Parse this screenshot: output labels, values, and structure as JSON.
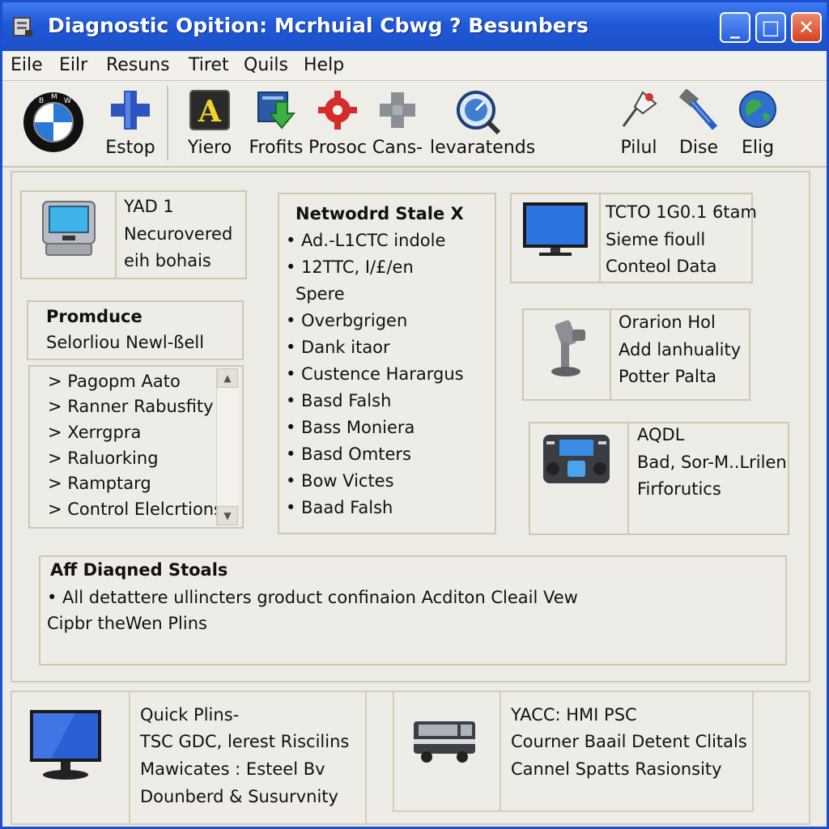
{
  "window": {
    "title": "Diagnostic Opition: Mcrhuial Cbwg ? Besunbers",
    "buttons": {
      "minimize": "_",
      "maximize": "□",
      "close": "✕"
    }
  },
  "menu": [
    "Eile",
    "Eilr",
    "Resuns",
    "Tiret",
    "Quils",
    "Help"
  ],
  "toolbar": {
    "left": [
      {
        "label": "",
        "icon": "bmw-logo-icon"
      },
      {
        "label": "Estop",
        "icon": "plus-icon"
      },
      {
        "label": "Yiero",
        "icon": "letter-a-icon"
      },
      {
        "label": "Frofits",
        "icon": "download-icon"
      },
      {
        "label": "Prosoc",
        "icon": "gear-icon"
      },
      {
        "label": "Cans-",
        "icon": "puzzle-icon"
      },
      {
        "label": "levaratends",
        "icon": "magnifier-icon"
      }
    ],
    "right": [
      {
        "label": "Pilul",
        "icon": "pin-icon"
      },
      {
        "label": "Dise",
        "icon": "hammer-icon"
      },
      {
        "label": "Elig",
        "icon": "globe-icon"
      }
    ]
  },
  "panels": {
    "device": {
      "lines": [
        "YAD 1",
        "Necurovered",
        "eih bohais"
      ]
    },
    "produce": {
      "title": "Promduce",
      "subtitle": "Selorliou Newl-ßell"
    },
    "produce_list": [
      "> Pagopm Aato",
      "> Ranner Rabusfity",
      "> Xerrgpra",
      "> Raluorking",
      "> Ramptarg",
      "> Control Elelcrtions"
    ],
    "network": {
      "title": "Netwodrd Stale X",
      "items": [
        "• Ad.-L1CTC indole",
        "• 12TTC, I/£/en",
        "Spere",
        "• Overbgrigen",
        "• Dank itaor",
        "• Custence Harargus",
        "• Basd Falsh",
        "• Bass Moniera",
        "• Basd Omters",
        "• Bow Victes",
        "• Baad Falsh"
      ]
    },
    "monitor": {
      "lines": [
        "TCTO 1G0.1 6tam",
        "Sieme fioull",
        "Conteol Data"
      ]
    },
    "orarion": {
      "lines": [
        "Orarion Hol",
        "Add lanhuality",
        "Potter Palta"
      ]
    },
    "aqdl": {
      "lines": [
        "AQDL",
        "Bad, Sor-M..Lrilen",
        "Firforutics"
      ]
    },
    "diagnosed": {
      "title": "Aff Diaqned Stoals",
      "line1": "• All  detattere ullincters groduct confinaion Acditon Cleail Vew",
      "line2": "Cipbr theWen Plins"
    },
    "quick": {
      "lines": [
        "Quick Plins-",
        "TSC GDC, lerest Riscilins",
        "Mawicates : Esteel Bv",
        "Dounberd & Susurvnity"
      ]
    },
    "yacc": {
      "lines": [
        "YACC: HMI PSC",
        "Courner Baail Detent Clitals",
        "Cannel Spatts Rasionsity"
      ]
    }
  },
  "colors": {
    "titlebar": "#1f58d6",
    "close": "#d4431f",
    "window_bg": "#ecebe6",
    "panel_border": "#cfc8ad"
  }
}
